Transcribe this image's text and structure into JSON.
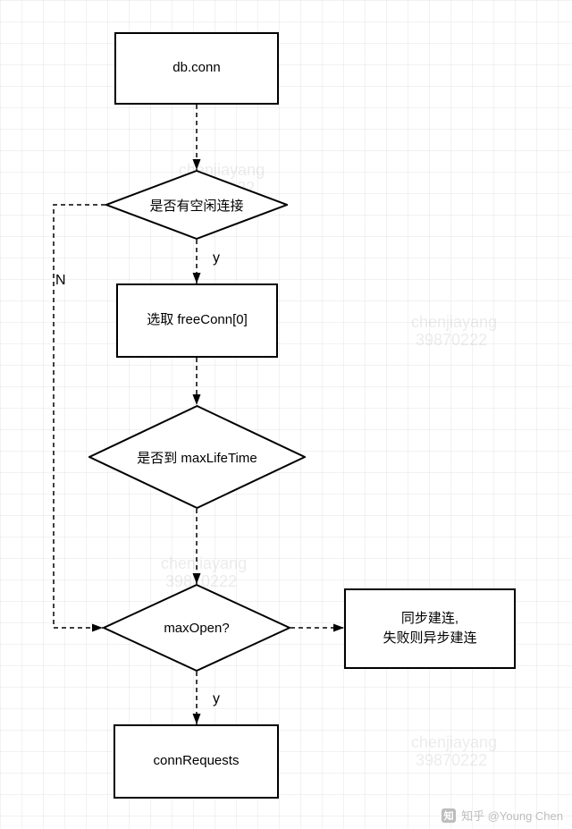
{
  "nodes": {
    "start": {
      "label": "db.conn"
    },
    "d_idle": {
      "label": "是否有空闲连接"
    },
    "pick": {
      "label": "选取 freeConn[0]"
    },
    "d_life": {
      "label": "是否到 maxLifeTime"
    },
    "d_open": {
      "label": "maxOpen?"
    },
    "sync": {
      "label": "同步建连,\n失败则异步建连"
    },
    "reqs": {
      "label": "connRequests"
    }
  },
  "edge_labels": {
    "idle_no": "N",
    "idle_yes": "y",
    "open_yes": "y"
  },
  "watermarks": [
    "chenjiayang",
    "39870222"
  ],
  "attribution": "知乎 @Young Chen"
}
